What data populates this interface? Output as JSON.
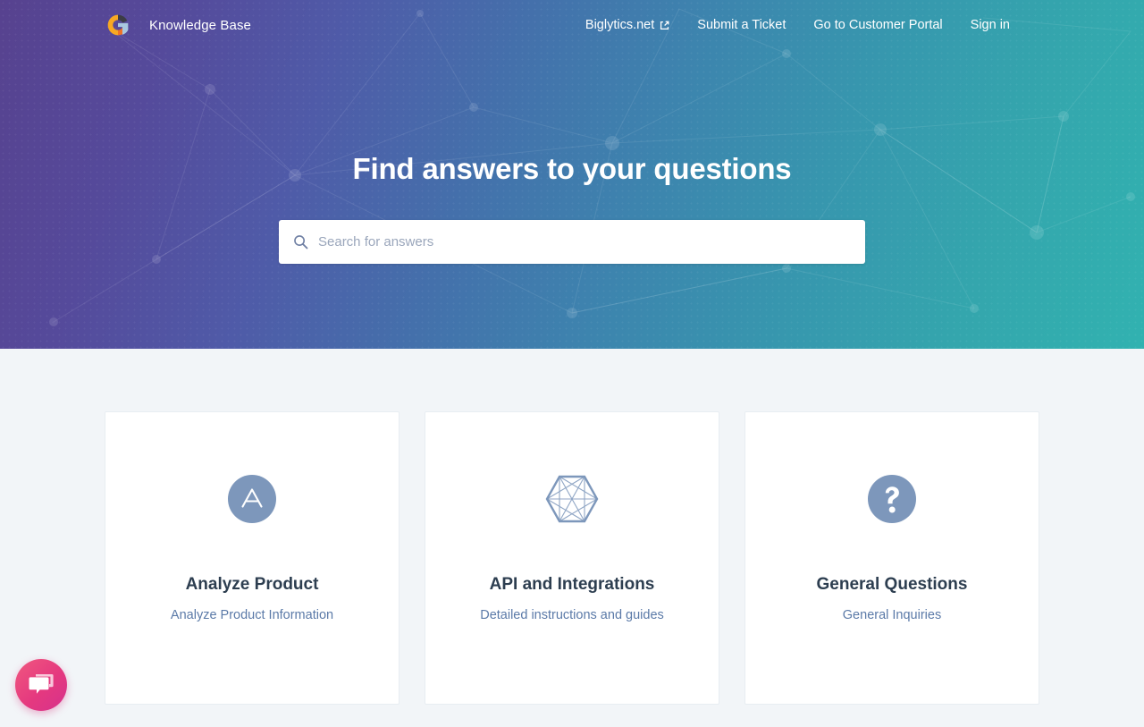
{
  "header": {
    "logo_icon": "google-g-logo-icon",
    "brand_title": "Knowledge Base",
    "nav": [
      {
        "label": "Biglytics.net",
        "icon": "external-link-icon",
        "external": true
      },
      {
        "label": "Submit a Ticket",
        "external": false
      },
      {
        "label": "Go to Customer Portal",
        "external": false
      },
      {
        "label": "Sign in",
        "external": false
      }
    ]
  },
  "hero": {
    "title": "Find answers to your questions",
    "search": {
      "icon": "search-icon",
      "value": "",
      "placeholder": "Search for answers"
    },
    "gradient_from": "#57428f",
    "gradient_to": "#31b2b0"
  },
  "cards": [
    {
      "icon": "letter-a-circle-icon",
      "title": "Analyze Product",
      "subtitle": "Analyze Product Information"
    },
    {
      "icon": "hexagon-network-icon",
      "title": "API and Integrations",
      "subtitle": "Detailed instructions and guides"
    },
    {
      "icon": "question-mark-circle-icon",
      "title": "General Questions",
      "subtitle": "General Inquiries"
    }
  ],
  "chat_widget": {
    "icon": "chat-bubbles-icon",
    "color": "#e5397f"
  },
  "page": {
    "background": "#f2f5f8",
    "icon_color": "#7d97bb",
    "title_color": "#2d3e50",
    "subtitle_color": "#5b7aa8"
  }
}
